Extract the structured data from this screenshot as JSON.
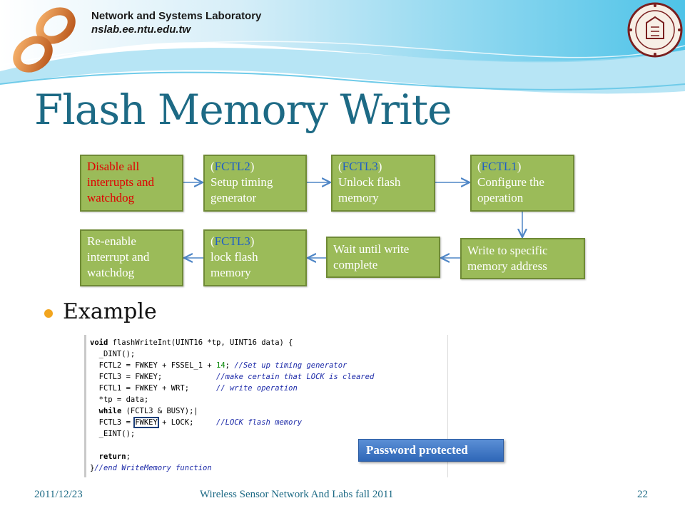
{
  "header": {
    "lab_name": "Network and Systems Laboratory",
    "lab_url": "nslab.ee.ntu.edu.tw"
  },
  "slide": {
    "title": "Flash Memory Write",
    "bullet": "Example"
  },
  "flow": {
    "boxes": [
      {
        "id": "disable",
        "lines": [
          "Disable all",
          "interrupts and",
          "watchdog"
        ],
        "color": "red"
      },
      {
        "id": "fctl2",
        "register": "FCTL2",
        "lines": [
          "Setup timing",
          "generator"
        ]
      },
      {
        "id": "fctl3-unlock",
        "register": "FCTL3",
        "lines": [
          "Unlock flash",
          "memory"
        ]
      },
      {
        "id": "fctl1",
        "register": "FCTL1",
        "lines": [
          "Configure the",
          "operation"
        ]
      },
      {
        "id": "write",
        "lines": [
          "Write to specific",
          "memory address"
        ]
      },
      {
        "id": "wait",
        "lines": [
          "Wait until write",
          "complete"
        ]
      },
      {
        "id": "fctl3-lock",
        "register": "FCTL3",
        "lines": [
          "lock flash",
          "memory"
        ]
      },
      {
        "id": "reenable",
        "lines": [
          "Re-enable",
          "interrupt and",
          "watchdog"
        ]
      }
    ]
  },
  "code": {
    "lines": [
      [
        {
          "t": "void",
          "c": "kw"
        },
        {
          "t": " flashWriteInt(UINT16 *tp, UINT16 data) {"
        }
      ],
      [
        {
          "t": "  _DINT();"
        }
      ],
      [
        {
          "t": "  FCTL2 = FWKEY + FSSEL_1 + "
        },
        {
          "t": "14",
          "c": "num"
        },
        {
          "t": "; "
        },
        {
          "t": "//Set up timing generator",
          "c": "cm"
        }
      ],
      [
        {
          "t": "  FCTL3 = FWKEY;            "
        },
        {
          "t": "//make certain that LOCK is cleared",
          "c": "cm"
        }
      ],
      [
        {
          "t": "  FCTL1 = FWKEY + WRT;      "
        },
        {
          "t": "// write operation",
          "c": "cm"
        }
      ],
      [
        {
          "t": "  *tp = data;"
        }
      ],
      [
        {
          "t": "  "
        },
        {
          "t": "while",
          "c": "kw"
        },
        {
          "t": " (FCTL3 & BUSY);|"
        }
      ],
      [
        {
          "t": "  FCTL3 = "
        },
        {
          "t": "FWKEY",
          "c": "hl"
        },
        {
          "t": " + LOCK;     "
        },
        {
          "t": "//LOCK flash memory",
          "c": "cm"
        }
      ],
      [
        {
          "t": "  _EINT();"
        }
      ],
      [
        {
          "t": ""
        }
      ],
      [
        {
          "t": "  "
        },
        {
          "t": "return",
          "c": "kw"
        },
        {
          "t": ";"
        }
      ],
      [
        {
          "t": "}"
        },
        {
          "t": "//end WriteMemory function",
          "c": "cm"
        }
      ]
    ],
    "callout": "Password protected"
  },
  "footer": {
    "date": "2011/12/23",
    "course": "Wireless Sensor Network And Labs fall 2011",
    "page": "22"
  },
  "colors": {
    "title": "#1d6a85",
    "box_fill": "#9bbb59",
    "box_border": "#6f8a36",
    "register_text": "#1f5fc6",
    "warning_text": "#e00000",
    "arrow": "#4f86c6",
    "callout": "#2f67b8"
  }
}
